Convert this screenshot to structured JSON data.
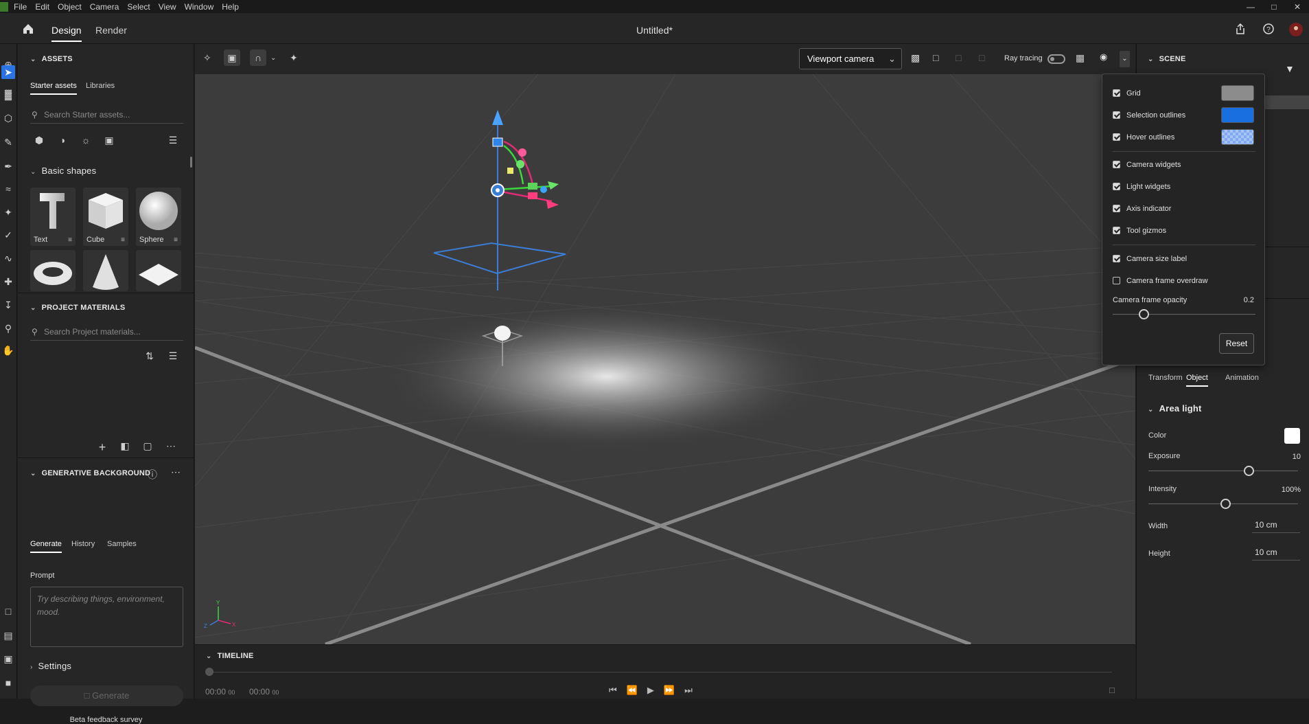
{
  "menubar": {
    "items": [
      "File",
      "Edit",
      "Object",
      "Camera",
      "Select",
      "View",
      "Window",
      "Help"
    ]
  },
  "header": {
    "tabs": {
      "design": "Design",
      "render": "Render"
    },
    "title": "Untitled*"
  },
  "assets": {
    "title": "ASSETS",
    "tabs": {
      "starter": "Starter assets",
      "libraries": "Libraries"
    },
    "search_placeholder": "Search Starter assets...",
    "basic_shapes_title": "Basic shapes",
    "shapes": [
      "Text",
      "Cube",
      "Sphere"
    ]
  },
  "project_materials": {
    "title": "PROJECT MATERIALS",
    "search_placeholder": "Search Project materials..."
  },
  "generative_background": {
    "title": "GENERATIVE BACKGROUND",
    "tabs": {
      "generate": "Generate",
      "history": "History",
      "samples": "Samples"
    },
    "prompt_label": "Prompt",
    "prompt_placeholder": "Try describing things, environment, mood.",
    "settings_label": "Settings",
    "generate_button": "Generate",
    "feedback_link": "Beta feedback survey"
  },
  "viewport_toolbar": {
    "camera_select": "Viewport camera",
    "ray_tracing_label": "Ray tracing"
  },
  "timeline": {
    "title": "TIMELINE",
    "time_current": "00:00",
    "time_current_frames": "00",
    "time_total": "00:00",
    "time_total_frames": "00"
  },
  "view_popup": {
    "options": [
      {
        "label": "Grid",
        "checked": true
      },
      {
        "label": "Selection outlines",
        "checked": true
      },
      {
        "label": "Hover outlines",
        "checked": true
      },
      {
        "label": "Camera widgets",
        "checked": true
      },
      {
        "label": "Light widgets",
        "checked": true
      },
      {
        "label": "Axis indicator",
        "checked": true
      },
      {
        "label": "Tool gizmos",
        "checked": true
      },
      {
        "label": "Camera size label",
        "checked": true
      },
      {
        "label": "Camera frame overdraw",
        "checked": false
      }
    ],
    "grid_color": "#8c8c8c",
    "selection_color": "#1a6fe0",
    "opacity_label": "Camera frame opacity",
    "opacity_value": "0.2",
    "reset_button": "Reset"
  },
  "scene_panel": {
    "title": "SCENE",
    "tabs": {
      "transform": "Transform",
      "object": "Object",
      "animation": "Animation"
    },
    "object_title": "Area light",
    "color_label": "Color",
    "exposure_label": "Exposure",
    "exposure_value": "10",
    "intensity_label": "Intensity",
    "intensity_value": "100%",
    "width_label": "Width",
    "width_value": "10 cm",
    "height_label": "Height",
    "height_value": "10 cm"
  }
}
